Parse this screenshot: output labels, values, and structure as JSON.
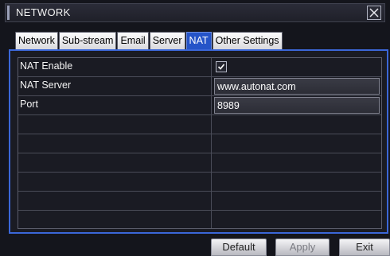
{
  "window": {
    "title": "NETWORK"
  },
  "tabs": [
    {
      "label": "Network",
      "active": false
    },
    {
      "label": "Sub-stream",
      "active": false
    },
    {
      "label": "Email",
      "active": false
    },
    {
      "label": "Server",
      "active": false
    },
    {
      "label": "NAT",
      "active": true
    },
    {
      "label": "Other Settings",
      "active": false
    }
  ],
  "nat": {
    "enable_label": "NAT Enable",
    "enable_checked": true,
    "server_label": "NAT Server",
    "server_value": "www.autonat.com",
    "port_label": "Port",
    "port_value": "8989"
  },
  "footer": {
    "default_label": "Default",
    "apply_label": "Apply",
    "exit_label": "Exit"
  },
  "colors": {
    "accent": "#2554c8",
    "panel_border": "#3b67d8"
  },
  "icons": {
    "close": "close-icon",
    "check": "checkmark-icon"
  }
}
